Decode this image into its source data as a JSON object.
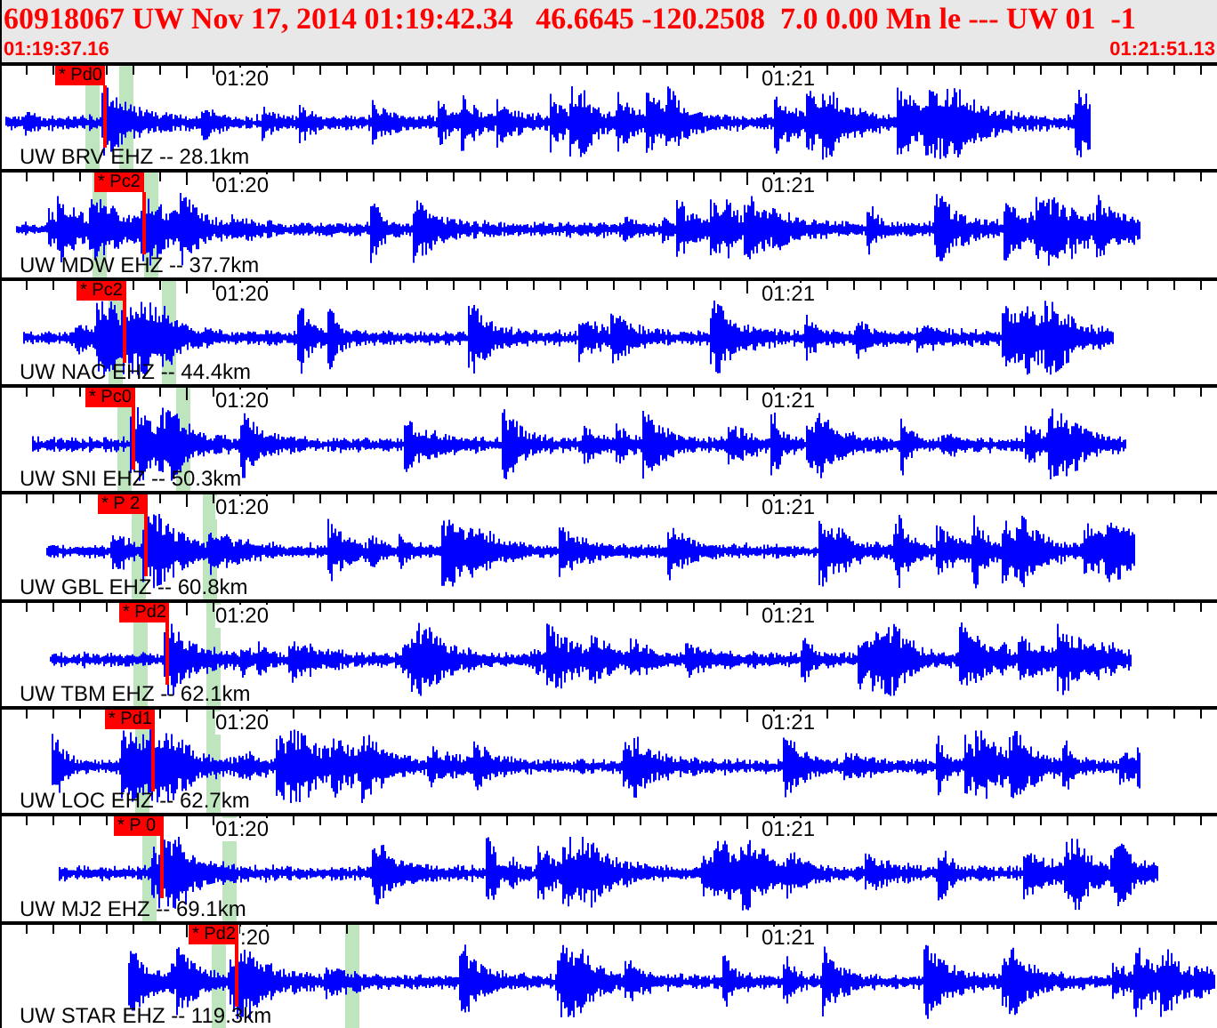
{
  "header": {
    "title": "60918067 UW Nov 17, 2014 01:19:42.34   46.6645 -120.2508  7.0 0.00 Mn le --- UW 01  -1",
    "start_time": "01:19:37.16",
    "end_time": "01:21:51.13"
  },
  "traces": [
    {
      "station": "UW BRV EHZ -- 28.1km",
      "pick": "* Pd0",
      "time_labels": [
        "01:20",
        "01:21"
      ]
    },
    {
      "station": "UW MDW EHZ -- 37.7km",
      "pick": "* Pc2",
      "time_labels": [
        "01:20",
        "01:21"
      ]
    },
    {
      "station": "UW NAC EHZ -- 44.4km",
      "pick": "* Pc2",
      "time_labels": [
        "01:20",
        "01:21"
      ]
    },
    {
      "station": "UW SNI EHZ -- 50.3km",
      "pick": "* Pc0",
      "time_labels": [
        "01:20",
        "01:21"
      ]
    },
    {
      "station": "UW GBL EHZ -- 60.8km",
      "pick": "* P 2",
      "time_labels": [
        "01:20",
        "01:21"
      ]
    },
    {
      "station": "UW TBM EHZ -- 62.1km",
      "pick": "* Pd2",
      "time_labels": [
        "01:20",
        "01:21"
      ]
    },
    {
      "station": "UW LOC EHZ -- 62.7km",
      "pick": "* Pd1",
      "time_labels": [
        "01:20",
        "01:21"
      ]
    },
    {
      "station": "UW MJ2 EHZ -- 69.1km",
      "pick": "* P 0",
      "time_labels": [
        "01:20",
        "01:21"
      ]
    },
    {
      "station": "UW STAR EHZ -- 119.3km",
      "pick": "* Pd2",
      "time_labels": [
        ":20",
        "01:21"
      ]
    }
  ]
}
